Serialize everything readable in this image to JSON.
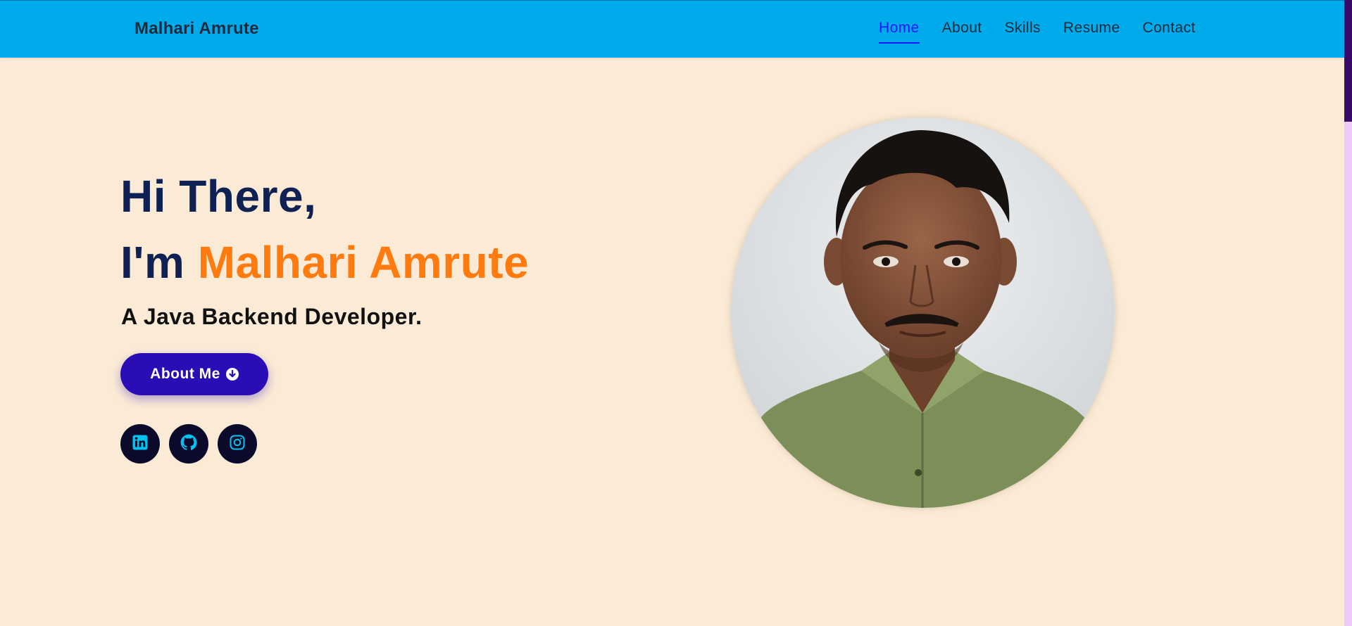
{
  "navbar": {
    "brand": "Malhari Amrute",
    "links": [
      {
        "label": "Home",
        "active": true
      },
      {
        "label": "About",
        "active": false
      },
      {
        "label": "Skills",
        "active": false
      },
      {
        "label": "Resume",
        "active": false
      },
      {
        "label": "Contact",
        "active": false
      }
    ]
  },
  "hero": {
    "greeting": "Hi There,",
    "intro_prefix": "I'm",
    "name": "Malhari Amrute",
    "role": "A Java Backend Developer.",
    "about_button": {
      "label": "About Me",
      "icon": "arrow-down-circle-icon"
    },
    "socials": [
      {
        "name": "linkedin",
        "icon": "linkedin-icon"
      },
      {
        "name": "github",
        "icon": "github-icon"
      },
      {
        "name": "instagram",
        "icon": "instagram-icon"
      }
    ]
  },
  "photo": {
    "alt": "profile photo"
  },
  "colors": {
    "navbar_bg": "#00abec",
    "page_bg": "#fbebd6",
    "heading": "#0e2152",
    "accent_name": "#ff7a0f",
    "button_bg": "#2a0db4",
    "nav_active": "#1b16ff",
    "social_bg": "#0b0a2b",
    "social_icon": "#00c2f0"
  }
}
